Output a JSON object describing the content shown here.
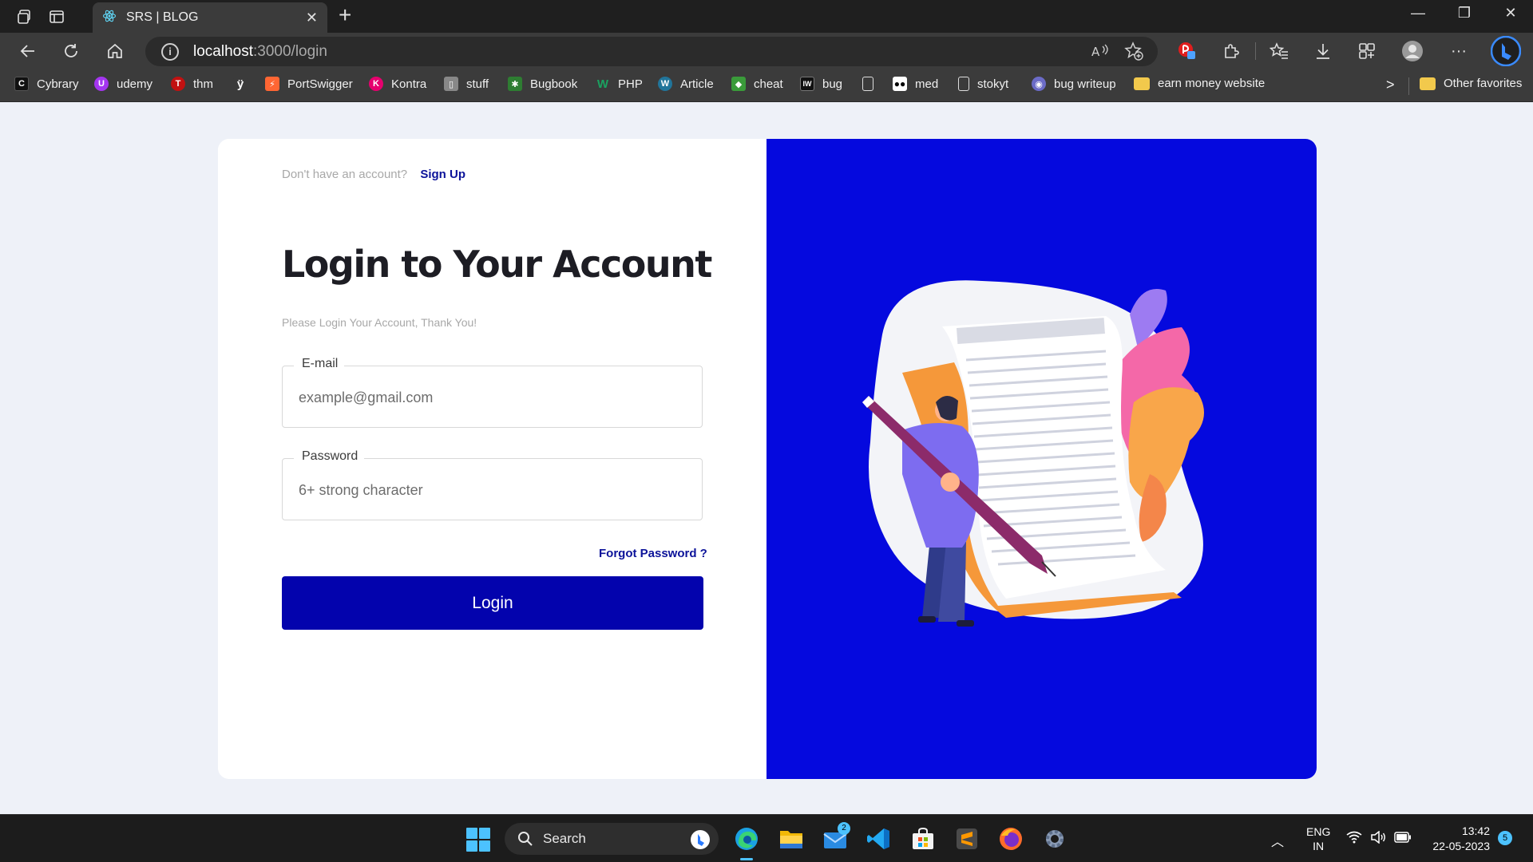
{
  "browser": {
    "tab_title": "SRS | BLOG",
    "tab_close": "✕",
    "new_tab": "+",
    "address_host": "localhost",
    "address_path": ":3000/login",
    "window_controls": {
      "minimize": "—",
      "restore": "❐",
      "close": "✕"
    },
    "toolbar_icons": [
      "back-arrow-icon",
      "refresh-icon",
      "home-icon",
      "info-icon",
      "read-aloud-icon",
      "add-favorite-icon",
      "extension-icon",
      "puzzle-icon",
      "favorites-icon",
      "download-icon",
      "collections-icon",
      "profile-icon",
      "more-icon",
      "bing-icon"
    ]
  },
  "bookmarks": {
    "items": [
      {
        "label": "Cybrary",
        "icon": "cybrary-icon",
        "color": "#111111"
      },
      {
        "label": "udemy",
        "icon": "udemy-icon",
        "color": "#a435f0"
      },
      {
        "label": "thm",
        "icon": "thm-icon",
        "color": "#c11111"
      },
      {
        "label": "",
        "icon": "bug-icon",
        "color": "#3b3b3b"
      },
      {
        "label": "PortSwigger",
        "icon": "portswigger-icon",
        "color": "#ff6633"
      },
      {
        "label": "Kontra",
        "icon": "kontra-icon",
        "color": "#e6006e"
      },
      {
        "label": "stuff",
        "icon": "stuff-icon",
        "color": "#888888"
      },
      {
        "label": "Bugbook",
        "icon": "bugbook-icon",
        "color": "#2e7d32"
      },
      {
        "label": "PHP",
        "icon": "php-icon",
        "color": "#1aa260"
      },
      {
        "label": "Article",
        "icon": "wordpress-icon",
        "color": "#21759b"
      },
      {
        "label": "cheat",
        "icon": "cheat-icon",
        "color": "#3a9b3a"
      },
      {
        "label": "bug",
        "icon": "iw-icon",
        "color": "#111111"
      },
      {
        "label": "",
        "icon": "page-icon",
        "color": "#3b3b3b"
      },
      {
        "label": "med",
        "icon": "medium-icon",
        "color": "#000000"
      },
      {
        "label": "stokyt",
        "icon": "page-icon",
        "color": "#3b3b3b"
      },
      {
        "label": "bug writeup",
        "icon": "writeup-icon",
        "color": "#6b6bc7"
      },
      {
        "label": "earn money website",
        "icon": "folder-icon",
        "color": "#f2c94c"
      }
    ],
    "overflow": ">",
    "other_favorites": "Other favorites"
  },
  "login": {
    "signup_prompt": "Don't have an account?",
    "signup_link": "Sign Up",
    "heading": "Login to Your Account",
    "subheading": "Please Login Your Account, Thank You!",
    "email_label": "E-mail",
    "email_placeholder": "example@gmail.com",
    "password_label": "Password",
    "password_placeholder": "6+ strong character",
    "forgot_link": "Forgot Password ?",
    "login_button": "Login"
  },
  "colors": {
    "accent_blue": "#0509de",
    "button_blue": "#0303ad",
    "link_blue": "#0b1299"
  },
  "taskbar": {
    "search_label": "Search",
    "mail_badge": "2",
    "apps": [
      "windows-start-icon",
      "edge-icon",
      "file-explorer-icon",
      "mail-icon",
      "vscode-icon",
      "store-icon",
      "sublime-icon",
      "firefox-icon",
      "settings-icon"
    ],
    "lang_line1": "ENG",
    "lang_line2": "IN",
    "time": "13:42",
    "date": "22-05-2023",
    "notification_count": "5"
  }
}
